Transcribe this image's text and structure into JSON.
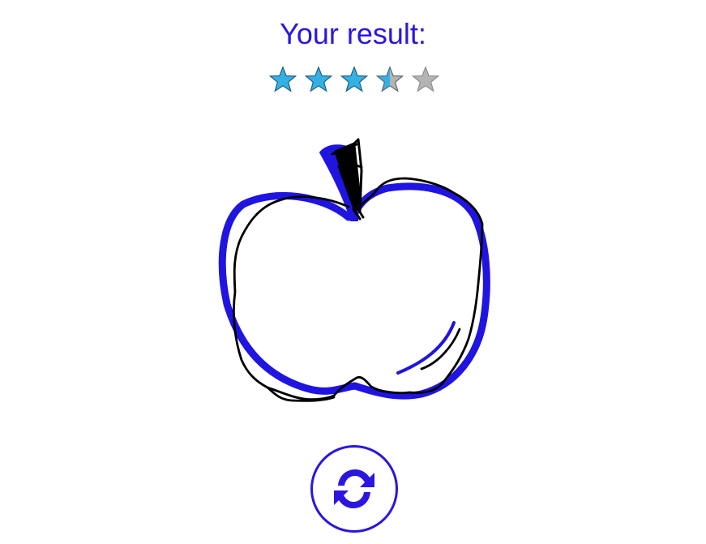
{
  "result": {
    "title": "Your result:",
    "rating": 3.5,
    "max_rating": 5,
    "accent_color": "#2a16e0",
    "star_filled_color": "#35b0e4",
    "star_empty_color": "#b4b4b4"
  },
  "drawing": {
    "subject": "apple",
    "reference_color": "#1f14e0",
    "user_stroke_color": "#000000"
  },
  "controls": {
    "retry_icon": "refresh-icon"
  }
}
